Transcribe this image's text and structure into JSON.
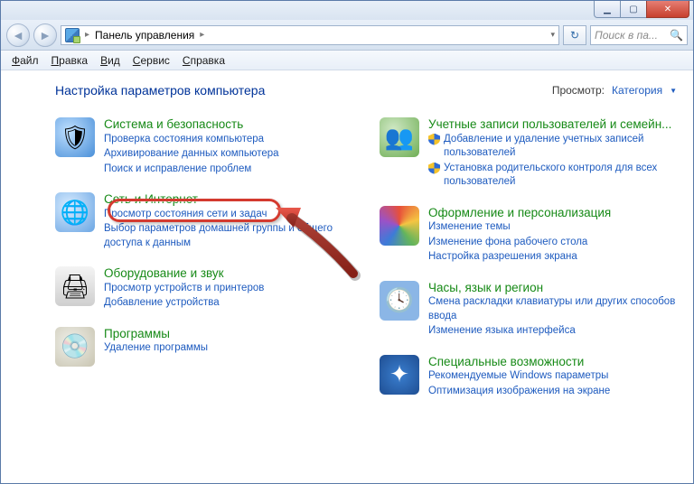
{
  "titlebar": {
    "min": "▁",
    "max": "▢",
    "close": "✕"
  },
  "navbar": {
    "back": "◄",
    "fwd": "►",
    "breadcrumb_root": "Панель управления",
    "sep1": "▸",
    "sep2": "▸",
    "refresh": "↻",
    "search_placeholder": "Поиск в па...",
    "search_icon": "🔍"
  },
  "menubar": {
    "file_u": "Ф",
    "file_r": "айл",
    "edit_u": "П",
    "edit_r": "равка",
    "view_u": "В",
    "view_r": "ид",
    "svc_u": "С",
    "svc_r": "ервис",
    "help_u": "С",
    "help_r": "правка"
  },
  "page": {
    "title": "Настройка параметров компьютера",
    "view_by_label": "Просмотр:",
    "view_by_value": "Категория"
  },
  "cats_left": [
    {
      "title": "Система и безопасность",
      "links": [
        "Проверка состояния компьютера",
        "Архивирование данных компьютера",
        "Поиск и исправление проблем"
      ]
    },
    {
      "title": "Сеть и Интернет",
      "links": [
        "Просмотр состояния сети и задач",
        "Выбор параметров домашней группы и общего доступа к данным"
      ]
    },
    {
      "title": "Оборудование и звук",
      "links": [
        "Просмотр устройств и принтеров",
        "Добавление устройства"
      ]
    },
    {
      "title": "Программы",
      "links": [
        "Удаление программы"
      ]
    }
  ],
  "cats_right": [
    {
      "title": "Учетные записи пользователей и семейн...",
      "shielded": [
        "Добавление и удаление учетных записей пользователей",
        "Установка родительского контроля для всех пользователей"
      ]
    },
    {
      "title": "Оформление и персонализация",
      "links": [
        "Изменение темы",
        "Изменение фона рабочего стола",
        "Настройка разрешения экрана"
      ]
    },
    {
      "title": "Часы, язык и регион",
      "links": [
        "Смена раскладки клавиатуры или других способов ввода",
        "Изменение языка интерфейса"
      ]
    },
    {
      "title": "Специальные возможности",
      "links": [
        "Рекомендуемые Windows параметры",
        "Оптимизация изображения на экране"
      ]
    }
  ]
}
